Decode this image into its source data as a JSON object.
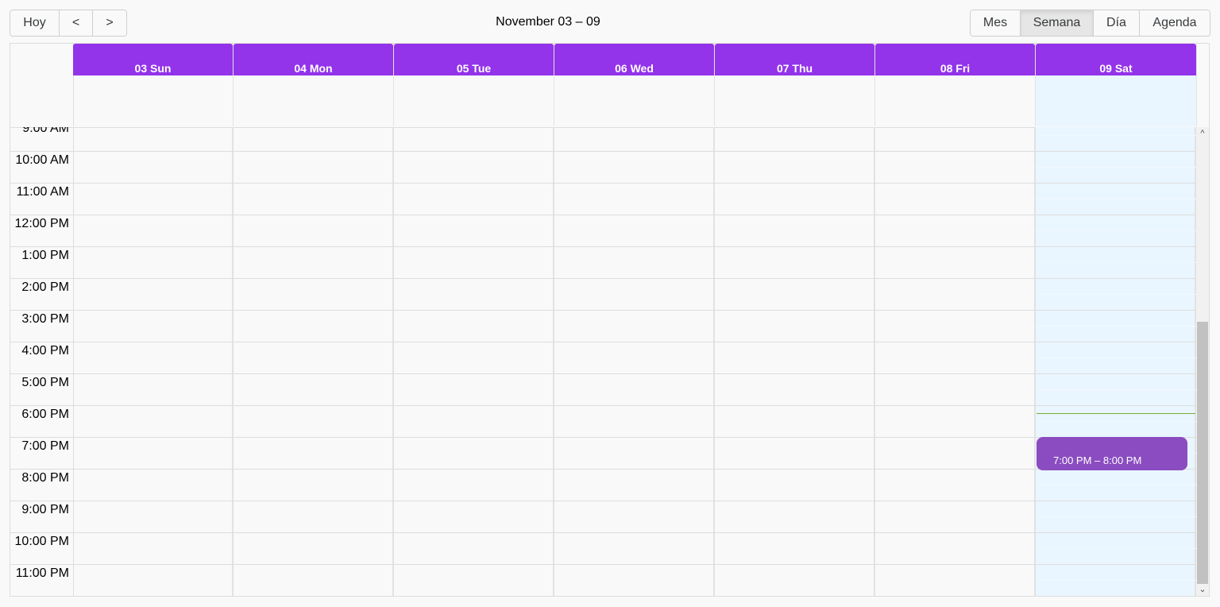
{
  "toolbar": {
    "today_label": "Hoy",
    "back_label": "<",
    "next_label": ">",
    "range_label": "November 03 – 09",
    "views": [
      {
        "label": "Mes",
        "active": false
      },
      {
        "label": "Semana",
        "active": true
      },
      {
        "label": "Día",
        "active": false
      },
      {
        "label": "Agenda",
        "active": false
      }
    ]
  },
  "days": [
    {
      "label": "03 Sun",
      "today": false
    },
    {
      "label": "04 Mon",
      "today": false
    },
    {
      "label": "05 Tue",
      "today": false
    },
    {
      "label": "06 Wed",
      "today": false
    },
    {
      "label": "07 Thu",
      "today": false
    },
    {
      "label": "08 Fri",
      "today": false
    },
    {
      "label": "09 Sat",
      "today": true
    }
  ],
  "time_slots": [
    "9:00 AM",
    "10:00 AM",
    "11:00 AM",
    "12:00 PM",
    "1:00 PM",
    "2:00 PM",
    "3:00 PM",
    "4:00 PM",
    "5:00 PM",
    "6:00 PM",
    "7:00 PM",
    "8:00 PM",
    "9:00 PM",
    "10:00 PM",
    "11:00 PM"
  ],
  "events": [
    {
      "day": "09 Sat",
      "time_label": "7:00 PM – 8:00 PM"
    }
  ],
  "colors": {
    "header_accent": "#9333ea",
    "event": "#8a4cc0",
    "today_bg": "#eaf6ff",
    "now_indicator": "#74ad31"
  },
  "icons": {
    "scroll_up": "chevron-up-icon",
    "scroll_down": "chevron-down-icon"
  }
}
